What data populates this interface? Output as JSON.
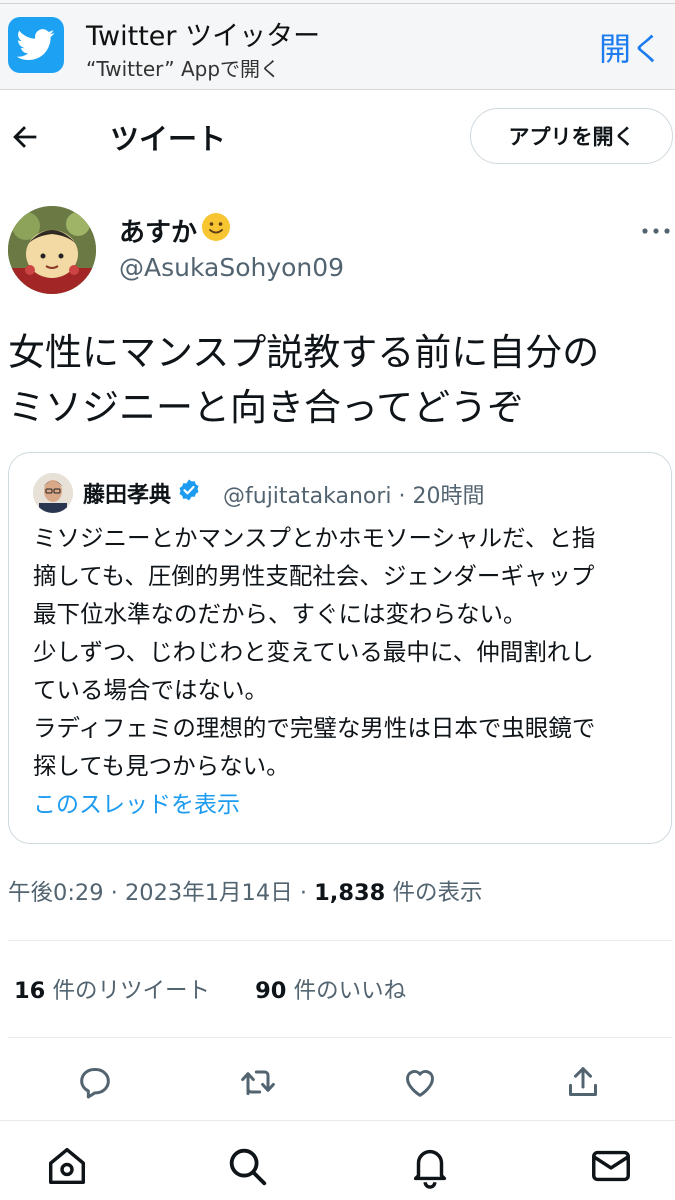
{
  "banner": {
    "app_title": "Twitter ツイッター",
    "app_subtitle": "“Twitter” Appで開く",
    "open_label": "開く"
  },
  "header": {
    "title": "ツイート",
    "open_app_label": "アプリを開く"
  },
  "tweet": {
    "author_name": "あすか",
    "author_emoji": "🙂",
    "author_handle": "@AsukaSohyon09",
    "text": "女性にマンスプ説教する前に自分の\nミソジニーと向き合ってどうぞ"
  },
  "quote": {
    "name": "藤田孝典",
    "handle_time": "@fujitatakanori · 20時間",
    "text": "ミソジニーとかマンスプとかホモソーシャルだ、と指\n摘しても、圧倒的男性支配社会、ジェンダーギャップ\n最下位水準なのだから、すぐには変わらない。\n少しずつ、じわじわと変えている最中に、仲間割れし\nている場合ではない。\nラディフェミの理想的で完璧な男性は日本で虫眼鏡で\n探しても見つからない。",
    "thread_link": "このスレッドを表示"
  },
  "meta": {
    "time_date": "午後0:29 · 2023年1月14日 · ",
    "views_count": "1,838",
    "views_label": " 件の表示"
  },
  "stats": {
    "retweets_count": "16",
    "retweets_label": " 件のリツイート",
    "likes_count": "90",
    "likes_label": " 件のいいね"
  },
  "icons": {
    "banner": "twitter-bird-icon",
    "back": "arrow-left-icon",
    "more": "more-horizontal-icon",
    "verified": "verified-badge-icon",
    "actions": [
      "reply-icon",
      "retweet-icon",
      "like-icon",
      "share-icon"
    ],
    "nav": [
      "home-icon",
      "search-icon",
      "notifications-icon",
      "messages-icon"
    ]
  },
  "colors": {
    "accent": "#1d9bf0",
    "banner_blue": "#1d7df0",
    "secondary_text": "#536471"
  }
}
